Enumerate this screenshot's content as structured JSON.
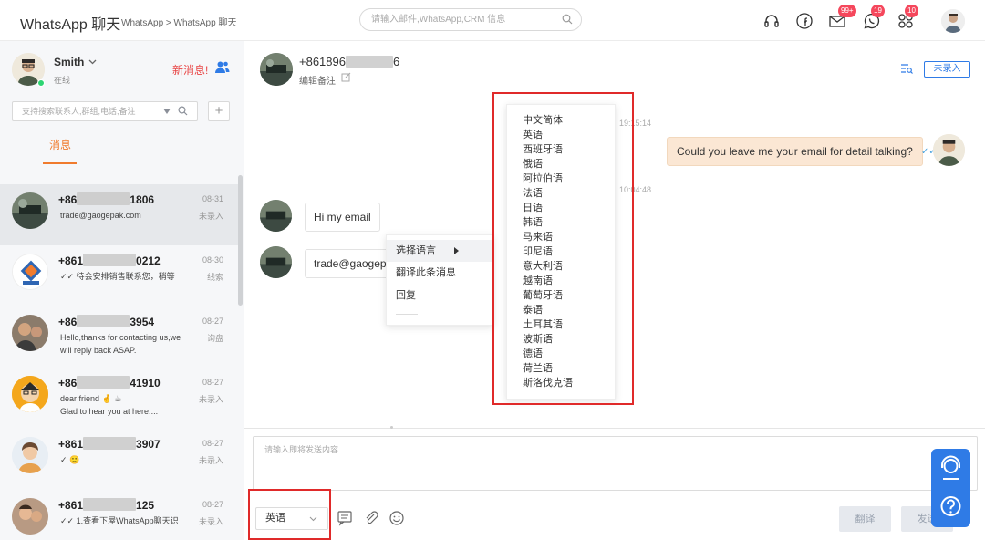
{
  "header": {
    "app_title": "WhatsApp 聊天",
    "breadcrumb": "WhatsApp > WhatsApp 聊天",
    "search_placeholder": "请输入邮件,WhatsApp,CRM 信息",
    "mail_badge": "99+",
    "whatsapp_badge": "19",
    "apps_badge": "10"
  },
  "profile": {
    "name": "Smith",
    "status": "在线",
    "new_message": "新消息!"
  },
  "sidebar": {
    "search_placeholder": "支持搜索联系人,群组,电话,备注",
    "add_label": "+",
    "tab_label": "消息",
    "conversations": [
      {
        "prefix": "+86",
        "suffix": "1806",
        "date": "08-31",
        "preview": "trade@gaogepak.com",
        "tag": "未录入"
      },
      {
        "prefix": "+861",
        "suffix": "0212",
        "date": "08-30",
        "preview": "✓✓ 待会安排销售联系您，稍等",
        "tag": "线索"
      },
      {
        "prefix": "+86",
        "suffix": "3954",
        "date": "08-27",
        "preview": "Hello,thanks for contacting us,we will reply back ASAP.",
        "tag": "询盘"
      },
      {
        "prefix": "+86",
        "suffix": "41910",
        "date": "08-27",
        "preview": "dear friend 🤞 ☕\nGlad to hear you at here....",
        "tag": "未录入"
      },
      {
        "prefix": "+861",
        "suffix": "3907",
        "date": "08-27",
        "preview": "✓ 🙂",
        "tag": "未录入"
      },
      {
        "prefix": "+861",
        "suffix": "125",
        "date": "08-27",
        "preview": "✓✓ 1.查看下屋WhatsApp聊天识",
        "tag": "未录入"
      }
    ]
  },
  "chat": {
    "contact_number_prefix": "+861896",
    "contact_number_suffix": "6",
    "note_label": "编辑备注",
    "unrecorded_label": "未录入",
    "timestamp_1": "19:15:14",
    "timestamp_2": "10:04:48",
    "outgoing_message": "Could you leave me your email for detail talking?",
    "incoming_1": "Hi my email",
    "incoming_2": "trade@gaogepak.com"
  },
  "context_menu": {
    "items": [
      "选择语言",
      "翻译此条消息",
      "回复"
    ]
  },
  "language_menu": {
    "items": [
      "中文简体",
      "英语",
      "西班牙语",
      "俄语",
      "阿拉伯语",
      "法语",
      "日语",
      "韩语",
      "马来语",
      "印尼语",
      "意大利语",
      "越南语",
      "葡萄牙语",
      "泰语",
      "土耳其语",
      "波斯语",
      "德语",
      "荷兰语",
      "斯洛伐克语"
    ]
  },
  "composer": {
    "placeholder": "请输入即将发送内容.....",
    "language_value": "英语",
    "translate_label": "翻译",
    "send_label": "发送"
  },
  "colors": {
    "accent": "#f07b2d",
    "highlight_box": "#e02a2a",
    "brand_blue": "#2f7be6",
    "outgoing_bubble": "#fbe7d4"
  }
}
